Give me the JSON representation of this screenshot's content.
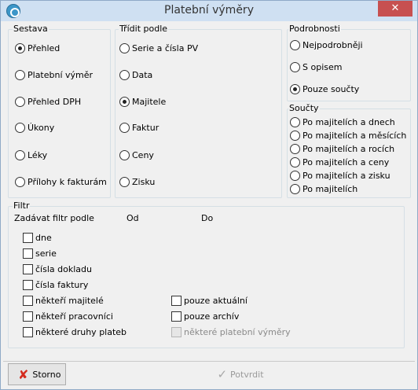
{
  "window": {
    "title": "Platební výměry",
    "close": "✕"
  },
  "sestava": {
    "label": "Sestava",
    "options": [
      {
        "label": "Přehled",
        "checked": true
      },
      {
        "label": "Platební výměr",
        "checked": false
      },
      {
        "label": "Přehled DPH",
        "checked": false
      },
      {
        "label": "Úkony",
        "checked": false
      },
      {
        "label": "Léky",
        "checked": false
      },
      {
        "label": "Přílohy k fakturám",
        "checked": false
      }
    ]
  },
  "tridit": {
    "label": "Třídit podle",
    "options": [
      {
        "label": "Serie a čísla PV",
        "checked": false
      },
      {
        "label": "Data",
        "checked": false
      },
      {
        "label": "Majitele",
        "checked": true
      },
      {
        "label": "Faktur",
        "checked": false
      },
      {
        "label": "Ceny",
        "checked": false
      },
      {
        "label": "Zisku",
        "checked": false
      }
    ]
  },
  "podrobnosti": {
    "label": "Podrobnosti",
    "options": [
      {
        "label": "Nejpodrobněji",
        "checked": false
      },
      {
        "label": "S opisem",
        "checked": false
      },
      {
        "label": "Pouze součty",
        "checked": true
      }
    ]
  },
  "soucty": {
    "label": "Součty",
    "options": [
      {
        "label": "Po majitelích a dnech",
        "checked": false
      },
      {
        "label": "Po majitelích a měsících",
        "checked": false
      },
      {
        "label": "Po majitelích a rocích",
        "checked": false
      },
      {
        "label": "Po majitelích a ceny",
        "checked": false
      },
      {
        "label": "Po majitelích a zisku",
        "checked": false
      },
      {
        "label": "Po majitelích",
        "checked": false
      }
    ]
  },
  "filtr": {
    "label": "Filtr",
    "header_by": "Zadávat filtr podle",
    "header_from": "Od",
    "header_to": "Do",
    "left_items": [
      {
        "label": "dne"
      },
      {
        "label": "serie"
      },
      {
        "label": "čísla dokladu"
      },
      {
        "label": "čísla faktury"
      },
      {
        "label": "někteří majitelé"
      },
      {
        "label": "někteří pracovníci"
      },
      {
        "label": "některé druhy plateb"
      }
    ],
    "right_items": [
      {
        "label": "pouze aktuální",
        "disabled": false
      },
      {
        "label": "pouze archív",
        "disabled": false
      },
      {
        "label": "některé platební výměry",
        "disabled": true
      }
    ]
  },
  "buttons": {
    "cancel": "Storno",
    "confirm": "Potvrdit"
  }
}
